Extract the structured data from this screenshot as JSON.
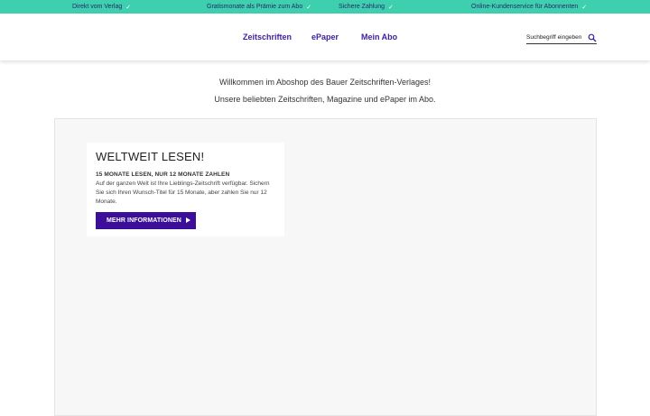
{
  "topbar": {
    "usps": [
      {
        "label": "Direkt vom Verlag",
        "check": "✓"
      },
      {
        "label": "Gratismonate als Prämie zum Abo",
        "check": "✓"
      },
      {
        "label": "Sichere Zahlung",
        "check": "✓"
      },
      {
        "label": "Online-Kundenservice für Abonnenten",
        "check": "✓"
      }
    ],
    "background": "#3ecfae"
  },
  "nav": {
    "items": [
      {
        "label": "Zeitschriften"
      },
      {
        "label": "ePaper"
      },
      {
        "label": "Mein Abo"
      }
    ],
    "color": "#3c1f9e"
  },
  "search": {
    "placeholder": "Suchbegriff eingeben",
    "icon": "search-icon"
  },
  "intro": {
    "line1": "Willkommen im Aboshop des Bauer Zeitschriften-Verlages!",
    "line2": "Unsere beliebten Zeitschriften, Magazine und ePaper im Abo."
  },
  "promo": {
    "title": "WELTWEIT LESEN!",
    "subtitle": "15 MONATE LESEN, NUR 12 MONATE ZAHLEN",
    "body": "Auf der ganzen Welt ist Ihre Lieblings-Zeitschrift verfügbar. Sichern Sie sich Ihren Wunsch-Titel für 15 Monate, aber zahlen Sie nur 12 Monate.",
    "cta_label": "MEHR INFORMATIONEN",
    "cta_color": "#3c0f99"
  }
}
